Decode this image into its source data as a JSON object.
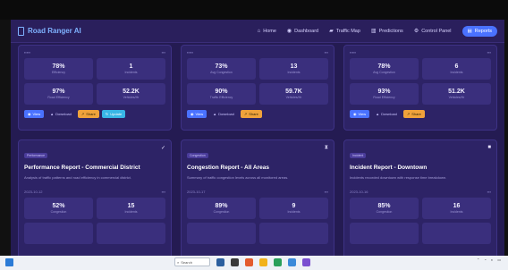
{
  "app": {
    "title": "Road Ranger AI"
  },
  "nav": {
    "links": [
      {
        "label": "Home",
        "icon": "home-icon"
      },
      {
        "label": "Dashboard",
        "icon": "dashboard-icon"
      },
      {
        "label": "Traffic Map",
        "icon": "car-icon"
      },
      {
        "label": "Predictions",
        "icon": "chart-icon"
      },
      {
        "label": "Control Panel",
        "icon": "sliders-icon"
      }
    ],
    "reports_button": "Reports"
  },
  "cards_top": [
    {
      "stats": [
        {
          "value": "78%",
          "label": "Efficiency"
        },
        {
          "value": "1",
          "label": "Incidents"
        },
        {
          "value": "97%",
          "label": "Road Efficiency"
        },
        {
          "value": "52.2K",
          "label": "Vehicles/Hr"
        }
      ],
      "actions": [
        "View",
        "Download",
        "Share",
        "Update"
      ]
    },
    {
      "stats": [
        {
          "value": "73%",
          "label": "Avg Congestion"
        },
        {
          "value": "13",
          "label": "Incidents"
        },
        {
          "value": "90%",
          "label": "Traffic Efficiency"
        },
        {
          "value": "59.7K",
          "label": "Vehicles/Hr"
        }
      ],
      "actions": [
        "View",
        "Download",
        "Share"
      ]
    },
    {
      "stats": [
        {
          "value": "78%",
          "label": "Avg Congestion"
        },
        {
          "value": "6",
          "label": "Incidents"
        },
        {
          "value": "93%",
          "label": "Road Efficiency"
        },
        {
          "value": "51.2K",
          "label": "Vehicles/Hr"
        }
      ],
      "actions": [
        "View",
        "Download",
        "Share"
      ]
    }
  ],
  "cards_bottom": [
    {
      "tag": "Performance",
      "title": "Performance Report - Commercial District",
      "description": "Analysis of traffic patterns and road efficiency in commercial district.",
      "date": "2023-10-12",
      "stats": [
        {
          "value": "52%",
          "label": "Congestion"
        },
        {
          "value": "15",
          "label": "Incidents"
        }
      ]
    },
    {
      "tag": "Congestion",
      "title": "Congestion Report - All Areas",
      "description": "Summary of traffic congestion levels across all monitored areas.",
      "date": "2023-10-17",
      "stats": [
        {
          "value": "89%",
          "label": "Congestion"
        },
        {
          "value": "9",
          "label": "Incidents"
        }
      ]
    },
    {
      "tag": "Incident",
      "title": "Incident Report - Downtown",
      "description": "Incidents recorded downtown with response time breakdown.",
      "date": "2023-10-16",
      "stats": [
        {
          "value": "85%",
          "label": "Congestion"
        },
        {
          "value": "16",
          "label": "Incidents"
        }
      ]
    }
  ],
  "taskbar": {
    "search_placeholder": "Search"
  }
}
